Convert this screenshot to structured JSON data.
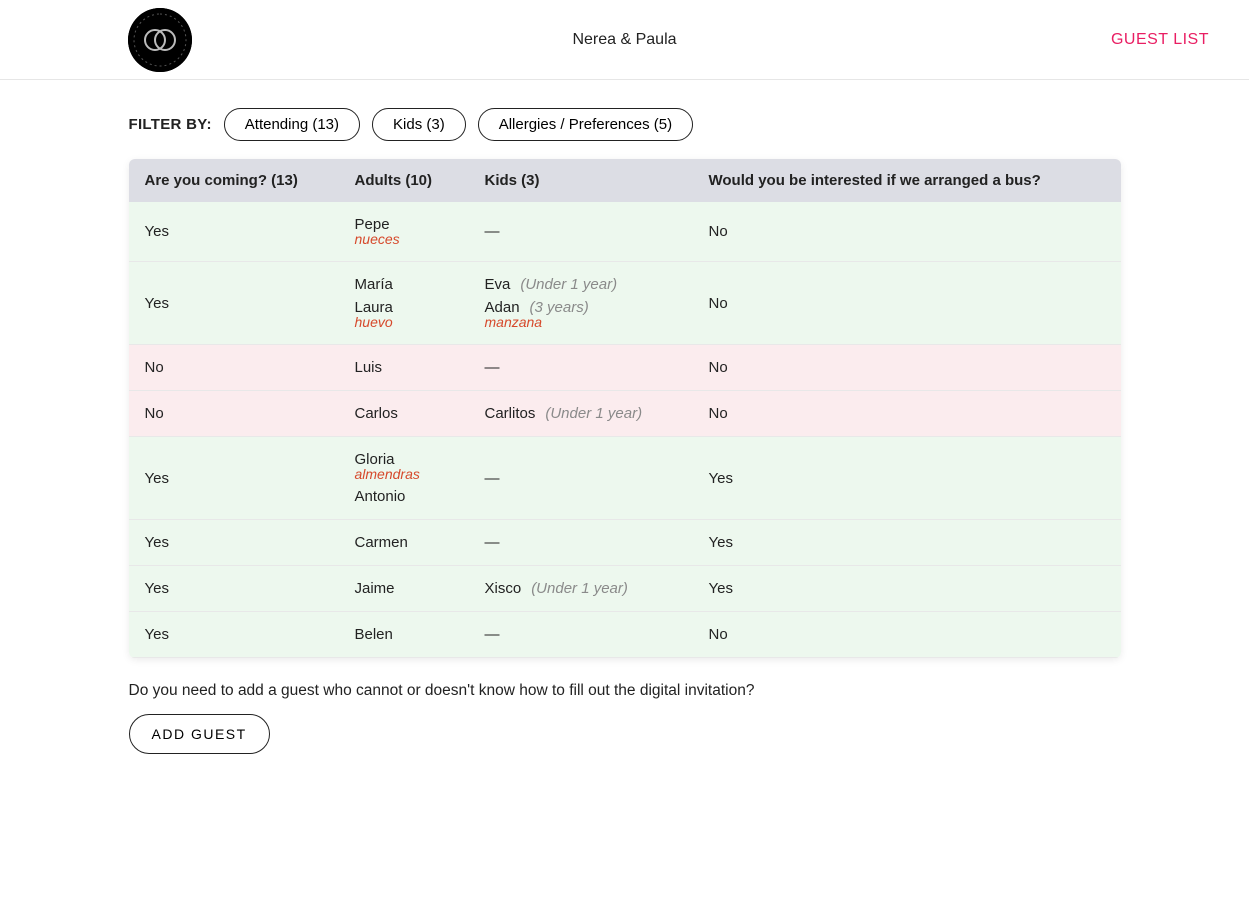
{
  "header": {
    "title": "Nerea & Paula",
    "link": "GUEST LIST"
  },
  "filter": {
    "label": "FILTER BY:",
    "chips": [
      "Attending (13)",
      "Kids (3)",
      "Allergies / Preferences (5)"
    ]
  },
  "table": {
    "headers": {
      "coming": "Are you coming? (13)",
      "adults": "Adults (10)",
      "kids": "Kids (3)",
      "bus": "Would you be interested if we arranged a bus?"
    },
    "rows": [
      {
        "coming": "Yes",
        "adults": [
          {
            "name": "Pepe",
            "allergy": "nueces"
          }
        ],
        "kids": [],
        "bus": "No"
      },
      {
        "coming": "Yes",
        "adults": [
          {
            "name": "María"
          },
          {
            "name": "Laura",
            "allergy": "huevo"
          }
        ],
        "kids": [
          {
            "name": "Eva",
            "age": "(Under 1 year)"
          },
          {
            "name": "Adan",
            "age": "(3 years)",
            "allergy": "manzana"
          }
        ],
        "bus": "No"
      },
      {
        "coming": "No",
        "adults": [
          {
            "name": "Luis"
          }
        ],
        "kids": [],
        "bus": "No"
      },
      {
        "coming": "No",
        "adults": [
          {
            "name": "Carlos"
          }
        ],
        "kids": [
          {
            "name": "Carlitos",
            "age": "(Under 1 year)"
          }
        ],
        "bus": "No"
      },
      {
        "coming": "Yes",
        "adults": [
          {
            "name": "Gloria",
            "allergy": "almendras"
          },
          {
            "name": "Antonio"
          }
        ],
        "kids": [],
        "bus": "Yes"
      },
      {
        "coming": "Yes",
        "adults": [
          {
            "name": "Carmen"
          }
        ],
        "kids": [],
        "bus": "Yes"
      },
      {
        "coming": "Yes",
        "adults": [
          {
            "name": "Jaime"
          }
        ],
        "kids": [
          {
            "name": "Xisco",
            "age": "(Under 1 year)"
          }
        ],
        "bus": "Yes"
      },
      {
        "coming": "Yes",
        "adults": [
          {
            "name": "Belen"
          }
        ],
        "kids": [],
        "bus": "No"
      }
    ]
  },
  "below": {
    "prompt": "Do you need to add a guest who cannot or doesn't know how to fill out the digital invitation?",
    "button": "ADD GUEST"
  },
  "dash": "—"
}
